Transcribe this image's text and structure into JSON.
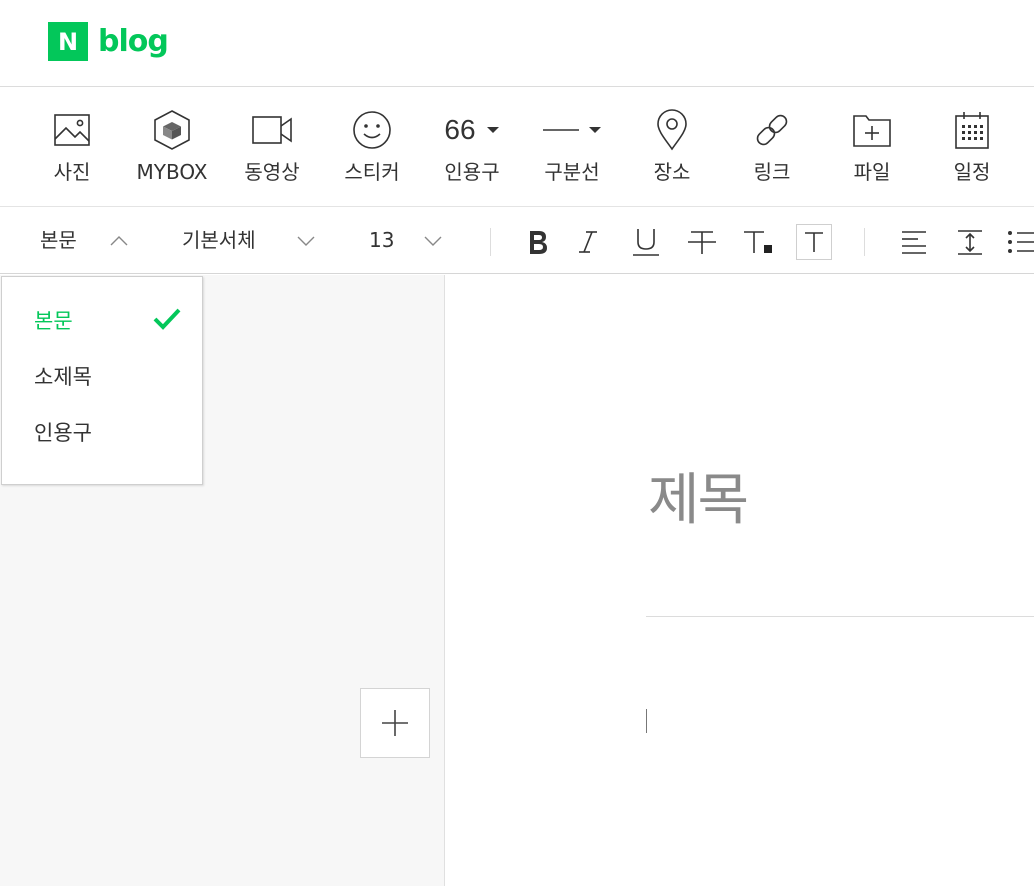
{
  "header": {
    "logo_mark": "N",
    "logo_text": "blog"
  },
  "insert_toolbar": {
    "items": [
      {
        "label": "사진",
        "icon": "image-icon"
      },
      {
        "label": "MYBOX",
        "icon": "mybox-icon"
      },
      {
        "label": "동영상",
        "icon": "video-icon"
      },
      {
        "label": "스티커",
        "icon": "smiley-icon"
      },
      {
        "label": "인용구",
        "icon": "quote-icon",
        "glyph": "66"
      },
      {
        "label": "구분선",
        "icon": "divider-icon"
      },
      {
        "label": "장소",
        "icon": "map-pin-icon"
      },
      {
        "label": "링크",
        "icon": "link-icon"
      },
      {
        "label": "파일",
        "icon": "file-add-icon"
      },
      {
        "label": "일정",
        "icon": "calendar-icon"
      }
    ]
  },
  "format_toolbar": {
    "paragraph_style": "본문",
    "font_family": "기본서체",
    "font_size": "13"
  },
  "style_dropdown": {
    "items": [
      {
        "label": "본문",
        "selected": true
      },
      {
        "label": "소제목",
        "selected": false
      },
      {
        "label": "인용구",
        "selected": false
      }
    ]
  },
  "editor": {
    "title_placeholder": "제목"
  },
  "colors": {
    "brand": "#03c75a",
    "panel_bg": "#f7f7f7"
  }
}
